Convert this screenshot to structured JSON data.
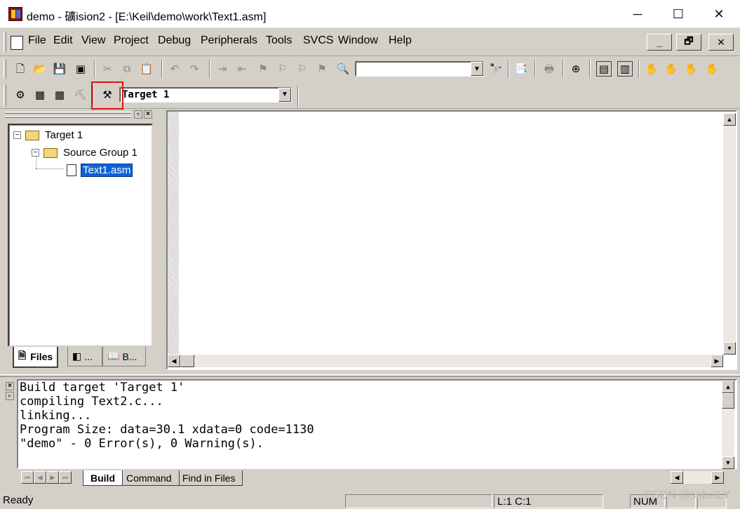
{
  "window": {
    "title": "demo  - 礦ision2 - [E:\\Keil\\demo\\work\\Text1.asm]",
    "minimize_glyph": "─",
    "maximize_glyph": "☐",
    "close_glyph": "✕"
  },
  "menubar": {
    "items": [
      "File",
      "Edit",
      "View",
      "Project",
      "Debug",
      "Peripherals",
      "Tools",
      "SVCS",
      "Window",
      "Help"
    ],
    "mdi_buttons": [
      "_",
      "🗗",
      "✕"
    ]
  },
  "toolbar1": {
    "find_combo_value": ""
  },
  "toolbar2": {
    "target_select": "Target 1"
  },
  "project_panel": {
    "tree": {
      "target": "Target 1",
      "group": "Source Group 1",
      "file": "Text1.asm"
    },
    "tabs": [
      "Files",
      "...",
      "B..."
    ]
  },
  "output": {
    "lines": [
      "Build target 'Target 1'",
      "compiling Text2.c...",
      "linking...",
      "Program Size: data=30.1 xdata=0 code=1130",
      "\"demo\" - 0 Error(s), 0 Warning(s)."
    ],
    "tabs": [
      "Build",
      "Command",
      "Find in Files"
    ]
  },
  "statusbar": {
    "status": "Ready",
    "position": "L:1 C:1",
    "num": "NUM"
  },
  "watermark": "CSDN @subeiLY",
  "colors": {
    "chrome": "#d4d0c8",
    "selection": "#0a64d8",
    "highlight_box": "#e01010"
  }
}
